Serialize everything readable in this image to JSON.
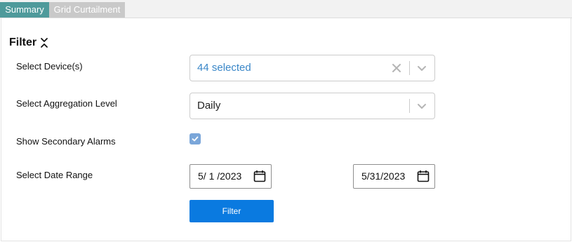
{
  "tabs": [
    {
      "label": "Summary",
      "active": true
    },
    {
      "label": "Grid Curtailment",
      "active": false
    }
  ],
  "filter": {
    "title": "Filter",
    "devices": {
      "label": "Select Device(s)",
      "value": "44 selected"
    },
    "aggregation": {
      "label": "Select Aggregation Level",
      "value": "Daily"
    },
    "secondary_alarms": {
      "label": "Show Secondary Alarms",
      "checked": true
    },
    "date_range": {
      "label": "Select Date Range",
      "start": "5/ 1 /2023",
      "end": "5/31/2023"
    },
    "button_label": "Filter"
  },
  "colors": {
    "tab_active": "#4e9a9b",
    "tab_inactive": "#c9c9c9",
    "accent_text": "#3a87c8",
    "checkbox": "#7aa6d9",
    "button": "#0a7ae0"
  }
}
